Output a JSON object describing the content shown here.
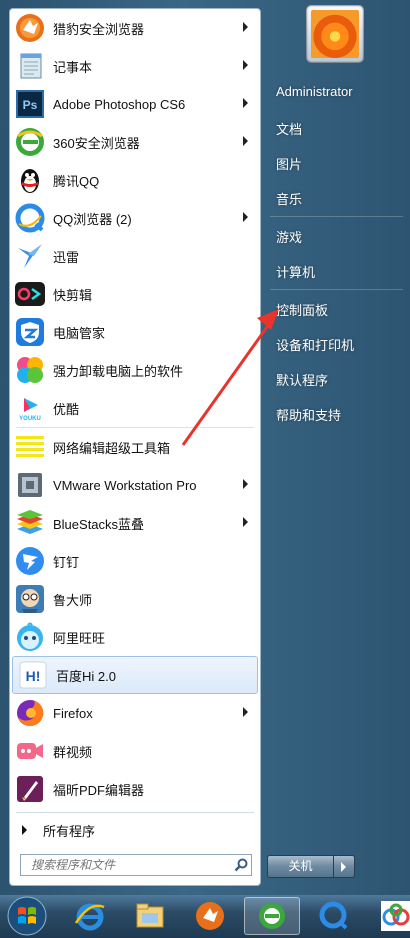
{
  "programs": [
    {
      "label": "猎豹安全浏览器",
      "icon": "cheetah-browser-icon",
      "arrow": true
    },
    {
      "label": "记事本",
      "icon": "notepad-icon",
      "arrow": true
    },
    {
      "label": "Adobe Photoshop CS6",
      "icon": "photoshop-icon",
      "arrow": true
    },
    {
      "label": "360安全浏览器",
      "icon": "360-browser-icon",
      "arrow": true
    },
    {
      "label": "腾讯QQ",
      "icon": "qq-penguin-icon",
      "arrow": false
    },
    {
      "label": "QQ浏览器 (2)",
      "icon": "qq-browser-icon",
      "arrow": true
    },
    {
      "label": "迅雷",
      "icon": "thunder-icon",
      "arrow": false
    },
    {
      "label": "快剪辑",
      "icon": "kuaijianji-icon",
      "arrow": false
    },
    {
      "label": "电脑管家",
      "icon": "pc-manager-icon",
      "arrow": false
    },
    {
      "label": "强力卸载电脑上的软件",
      "icon": "uninstall-icon",
      "arrow": false
    },
    {
      "label": "优酷",
      "icon": "youku-icon",
      "arrow": false
    },
    {
      "label": "网络编辑超级工具箱",
      "icon": "toolbox-icon",
      "arrow": false
    },
    {
      "label": "VMware Workstation Pro",
      "icon": "vmware-icon",
      "arrow": true
    },
    {
      "label": "BlueStacks蓝叠",
      "icon": "bluestacks-icon",
      "arrow": true
    },
    {
      "label": "钉钉",
      "icon": "dingtalk-icon",
      "arrow": false
    },
    {
      "label": "鲁大师",
      "icon": "ludashi-icon",
      "arrow": false
    },
    {
      "label": "阿里旺旺",
      "icon": "aliwangwang-icon",
      "arrow": false
    },
    {
      "label": "百度Hi 2.0",
      "icon": "baidu-hi-icon",
      "arrow": false,
      "selected": true
    },
    {
      "label": "Firefox",
      "icon": "firefox-icon",
      "arrow": true
    },
    {
      "label": "群视频",
      "icon": "group-video-icon",
      "arrow": false
    },
    {
      "label": "福昕PDF编辑器",
      "icon": "foxit-pdf-icon",
      "arrow": false
    }
  ],
  "all_programs": "所有程序",
  "search": {
    "placeholder": "搜索程序和文件"
  },
  "right_menu": {
    "user": "Administrator",
    "items": [
      "文档",
      "图片",
      "音乐",
      "游戏",
      "计算机",
      "控制面板",
      "设备和打印机",
      "默认程序",
      "帮助和支持"
    ]
  },
  "shutdown_label": "关机",
  "taskbar": [
    "start-orb-icon",
    "ie-icon",
    "explorer-icon",
    "cheetah-browser-icon",
    "360-browser-icon",
    "qq-browser-icon",
    "baidu-netdisk-icon"
  ],
  "annotation_color": "#e8342c"
}
